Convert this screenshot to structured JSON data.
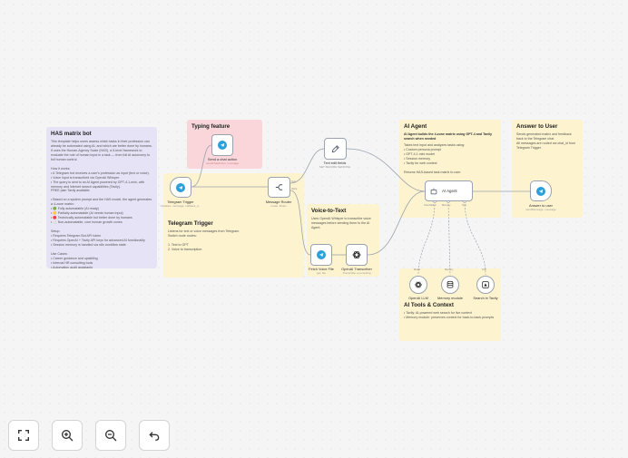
{
  "notes": {
    "has": {
      "title": "HAS matrix bot",
      "body": "This template helps users assess which tasks in their profession can already be automated using AI, and which are better done by humans. It uses the Human-Agency Scale (HAS), a 5-level framework to evaluate the role of human input in a task — from full AI autonomy to full human control.\n\nHow it works:\n• A Telegram bot receives a user's profession as input (text or voice).\n• Voice input is transcribed via OpenAI Whisper.\n• The query is sent to an AI Agent powered by GPT-4.1-mini, with memory and internet search capabilities (Tavily).\nFREE plan Tavily available.\n\n• Based on a system prompt and the HAS model, the agent generates a 4-zone matrix:\n• 🟢 Fully automatable (AI ready)\n• 🟡 Partially automatable (AI needs human input)\n• 🔴 Technically automatable but better done by humans\n• ⚪ Non-automatable, core human growth zones\n\nSetup:\n• Requires Telegram Bot API token\n• Requires OpenAI + Tavily API keys for advanced AI functionality\n• Session memory is handled via n8n workflow state\n\nUse Cases:\n• Career guidance and upskilling\n• Internal HR consulting tools\n• Automation audit assistants"
    },
    "typing": {
      "title": "Typing feature"
    },
    "telegram_trigger": {
      "title": "Telegram Trigger",
      "body": "Listens for text or voice messages from Telegram.\nSwitch route routes:\n\n1. Text to GPT\n2. Voice to transcription"
    },
    "voice": {
      "title": "Voice-to-Text",
      "body": "Uses OpenAI Whisper to transcribe voice messages before sending them to the AI Agent."
    },
    "agent": {
      "title": "AI Agent",
      "lead": "AI Agent builds the 4-zone matrix using GPT-4 and Tavily search when needed",
      "body": "Takes text input and analyzes tasks using:\n• Custom persona prompt\n• GPT-4.1 mini model\n• Session memory\n• Tavily for web context\n\nReturns HAS-based task matrix to user."
    },
    "answer": {
      "title": "Answer to User",
      "body": "Sends generated matrix and feedback back to the Telegram chat.\nAll messages are routed via chat_id from Telegram Trigger."
    },
    "tools": {
      "title": "AI Tools & Context",
      "body": "• Tavily: AI-powered web search for live context\n• Memory module: preserves context for back-to-back prompts"
    }
  },
  "nodes": {
    "telegram_trigger": {
      "label": "Telegram Trigger",
      "sub": "Updates: message, callback_q..."
    },
    "send_chat_action": {
      "label": "Send a chat action",
      "sub": "sendChatAction: message"
    },
    "message_router": {
      "label": "Message Router",
      "sub": "mode: Rules"
    },
    "text_edit": {
      "label": "Text edit fields",
      "sub": "SET BEFORE SENDING"
    },
    "fetch_voice": {
      "label": "Fetch Voice File",
      "sub": "get: file"
    },
    "transcriber": {
      "label": "OpenAI Transcriber",
      "sub": "Transcribe a recording"
    },
    "ai_agent": {
      "label": "AI Agent"
    },
    "answer": {
      "label": "Answer to user",
      "sub": "sendMessage: message"
    },
    "openai_llm": {
      "label": "OpenAI LLM"
    },
    "memory": {
      "label": "Memory module"
    },
    "tavily": {
      "label": "Search in Tavily"
    }
  },
  "ports": {
    "router_out_1": "Text",
    "router_out_2": "Voice",
    "agent_model": "Chat Model",
    "agent_memory": "Memory",
    "agent_tool": "Tool",
    "model_lbl": "Model",
    "memory_lbl": "Memory",
    "tool_lbl": "Tool"
  },
  "controls": {
    "fit": "fit-view",
    "zoom_in": "zoom-in",
    "zoom_out": "zoom-out",
    "undo": "undo"
  },
  "colors": {
    "telegram": "#2aa0db",
    "note_yellow": "#fdf3cf",
    "note_purple": "#e6e3f7",
    "note_pink": "#fad6da",
    "wire": "#9aa3ad"
  }
}
